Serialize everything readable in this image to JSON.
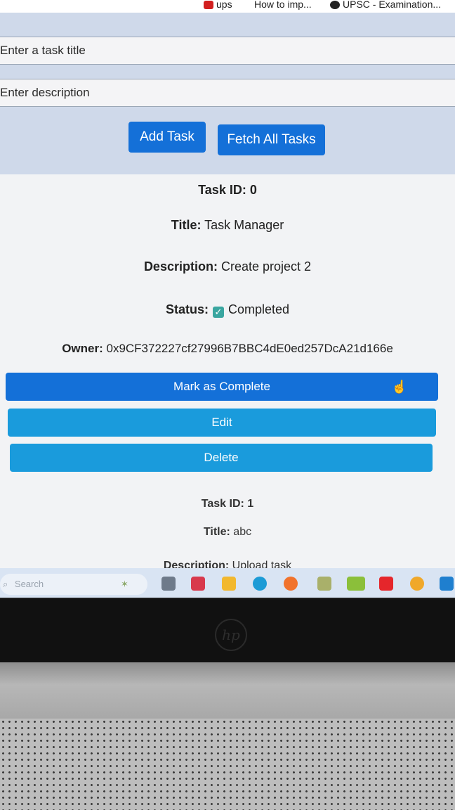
{
  "bookmarks": [
    {
      "label": "ups",
      "color": "#d21f1f"
    },
    {
      "label": "How to imp...",
      "color": ""
    },
    {
      "label": "UPSC - Examination...",
      "color": "#222222"
    }
  ],
  "form": {
    "title_placeholder": "Enter a task title",
    "description_placeholder": "Enter description",
    "add_label": "Add Task",
    "fetch_label": "Fetch All Tasks"
  },
  "tasks": [
    {
      "id_label": "Task ID:",
      "id": "0",
      "title_label": "Title:",
      "title": "Task Manager",
      "desc_label": "Description:",
      "description": "Create project 2",
      "status_label": "Status:",
      "status_icon": "checkbox-checked-icon",
      "status": "Completed",
      "owner_label": "Owner:",
      "owner": "0x9CF372227cf27996B7BBC4dE0ed257DcA21d166e",
      "complete_label": "Mark as Complete",
      "edit_label": "Edit",
      "delete_label": "Delete"
    },
    {
      "id_label": "Task ID:",
      "id": "1",
      "title_label": "Title:",
      "title": "abc",
      "desc_label": "Description:",
      "description": "Upload task"
    }
  ],
  "taskbar": {
    "search_placeholder": "Search",
    "icons": [
      "widgets-icon",
      "task-view-icon",
      "mcafee-icon",
      "file-explorer-icon",
      "edge-icon",
      "firefox-icon",
      "calculator-icon",
      "meesho-icon",
      "youtube-icon",
      "chrome-icon",
      "vscode-icon"
    ]
  },
  "colors": {
    "primary_button": "#1470d8",
    "secondary_button": "#1a9bdc",
    "status_check": "#3aa6a0"
  },
  "device": {
    "logo_text": "hp"
  }
}
